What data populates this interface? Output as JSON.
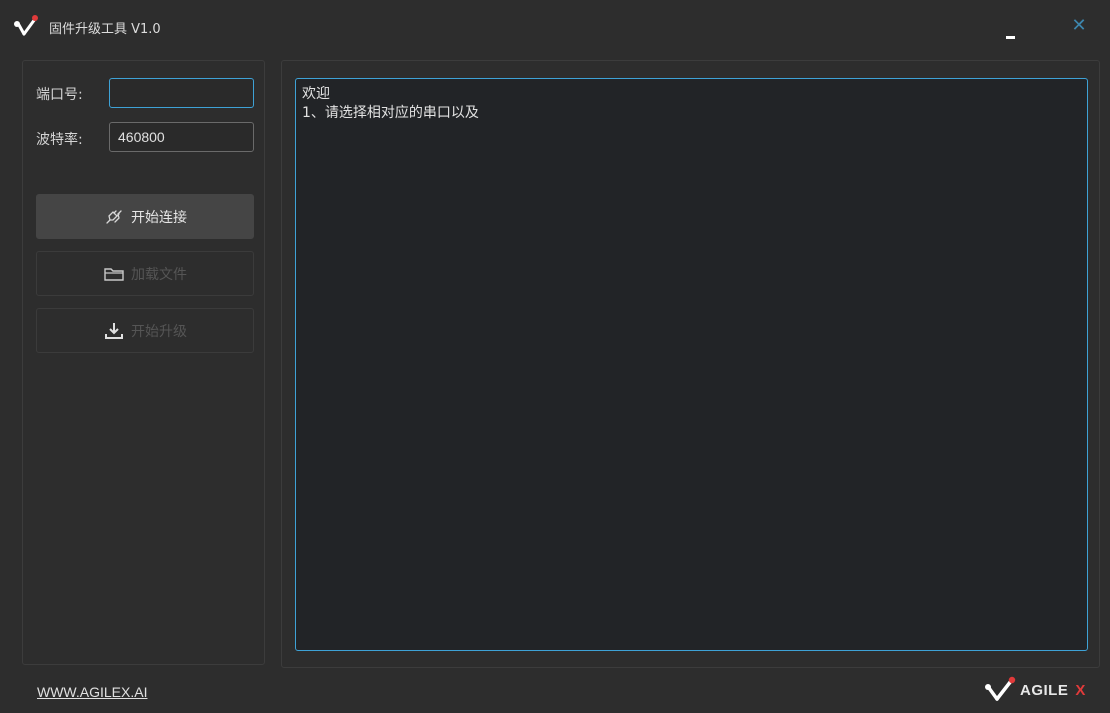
{
  "window": {
    "title": "固件升级工具 V1.0",
    "minimize_icon": "minimize-icon",
    "close_icon": "close-icon",
    "close_glyph": "✕"
  },
  "sidebar": {
    "port": {
      "label": "端口号:",
      "value": ""
    },
    "baud": {
      "label": "波特率:",
      "value": "460800"
    },
    "buttons": [
      {
        "label": "开始连接",
        "icon": "plug-icon",
        "enabled": true
      },
      {
        "label": "加载文件",
        "icon": "folder-icon",
        "enabled": false
      },
      {
        "label": "开始升级",
        "icon": "download-icon",
        "enabled": false
      }
    ]
  },
  "log": {
    "lines": [
      "欢迎",
      "1、请选择相对应的串口以及"
    ]
  },
  "footer": {
    "link": "WWW.AGILEX.AI",
    "brand": "AGILE",
    "brand_x": "X"
  },
  "colors": {
    "accent": "#3ea2d6",
    "brand_red": "#e03a3a",
    "background": "#2d2d2d"
  }
}
